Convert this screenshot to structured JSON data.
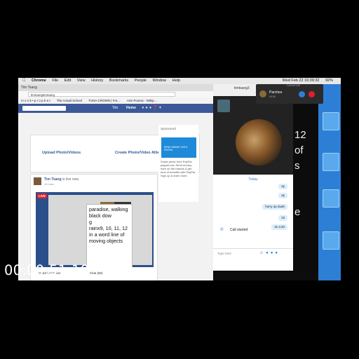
{
  "menubar": {
    "app": "Chrome",
    "items": [
      "File",
      "Edit",
      "View",
      "History",
      "Bookmarks",
      "People",
      "Window",
      "Help"
    ],
    "clock": "Wed Feb 22  16:39:32",
    "battery": "92%"
  },
  "chrome": {
    "tab": "Tim Tsang",
    "address": "timtsangtimtsang",
    "bookmarks": [
      "m o n k • p r o p h e t",
      "The Actual School",
      "TUNA CROWN | Fra…",
      "Arte Povera - Wikip…"
    ],
    "fb_name": "Tim",
    "fb_home": "Home"
  },
  "upload": {
    "photo_label": "Upload Photo/Videos",
    "album_label": "Create Photo/Video Album"
  },
  "sponsored": {
    "title": "Sponsored",
    "ad_text": "SEND MONEY WITH PAYPAL",
    "body": "Smart perks from PayPal paypal.com Send money, earn on the brands & get tons of benefits with PayPal. Sign up & learn more."
  },
  "post": {
    "author": "Tim Tsang",
    "status": "is live now.",
    "time": "18 mins",
    "live_badge": "LIVE",
    "notes": [
      "paradise, walking",
      "black dow",
      "g",
      "rainx9, 10, 11, 12",
      "in a word line of",
      "moving objects"
    ],
    "footer_left": "Andrée Azzolina",
    "footer_right": "Chat (80)"
  },
  "skype": {
    "contact": "timtsang3",
    "day": "Today",
    "messages": [
      "ay",
      "ay",
      "hurry up dude",
      "lol",
      "its 4:20"
    ],
    "call_started": "Call started",
    "type_placeholder": "Type here",
    "bg_text": [
      "12",
      "of",
      "s",
      "",
      "",
      "e"
    ]
  },
  "callpop": {
    "label": "Current Call",
    "name": "Parches",
    "status": "00:00"
  },
  "timecode": "00:00:51;10",
  "colors": {
    "facebook_blue": "#3b5998",
    "skype_blue": "#2d7fd6",
    "live_red": "#e0202c",
    "desktop_blue": "#2d7fd6"
  }
}
